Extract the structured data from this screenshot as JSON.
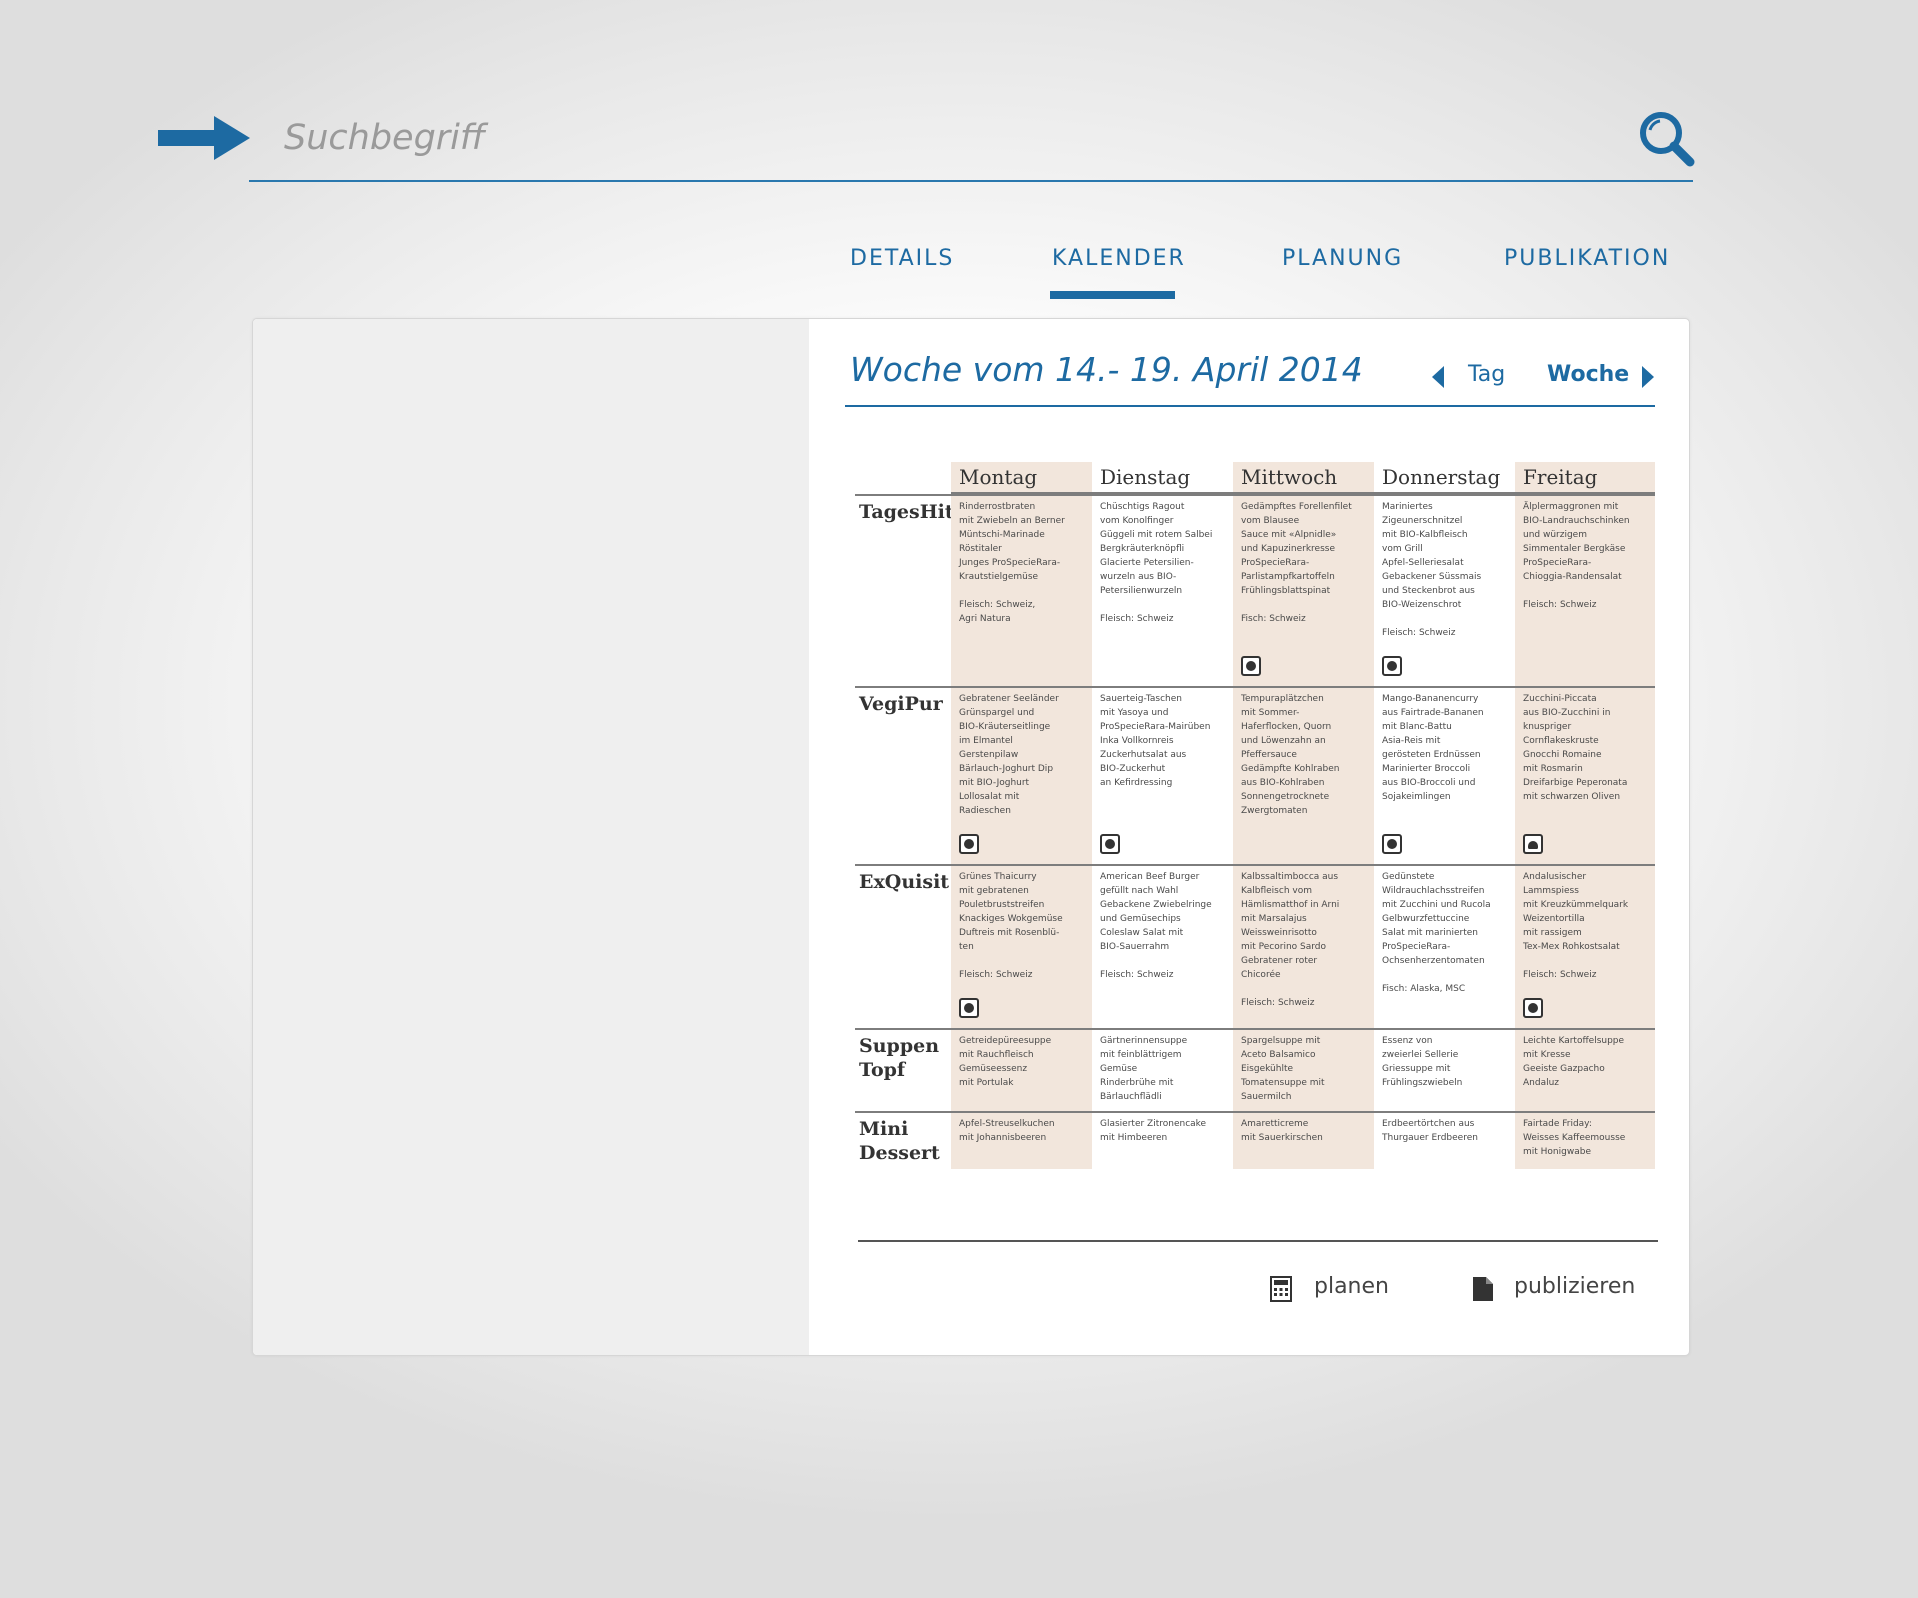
{
  "search": {
    "placeholder": "Suchbegriff"
  },
  "tabs": [
    {
      "label": "DETAILS"
    },
    {
      "label": "KALENDER",
      "active": true
    },
    {
      "label": "PLANUNG"
    },
    {
      "label": "PUBLIKATION"
    }
  ],
  "calendar": {
    "week_title": "Woche vom 14.- 19. April 2014",
    "nav_day": "Tag",
    "nav_week": "Woche"
  },
  "menu": {
    "days": [
      "Montag",
      "Dienstag",
      "Mittwoch",
      "Donnerstag",
      "Freitag"
    ],
    "rows": [
      {
        "label": "TagesHit",
        "cells": [
          {
            "text": "Rinderrostbraten\nmit Zwiebeln an Berner\nMüntschi-Marinade\nRöstitaler\nJunges ProSpecieRara-\nKrautstielgemüse\n\nFleisch: Schweiz,\nAgri Natura",
            "badge": ""
          },
          {
            "text": "Chüschtigs Ragout\nvom Konolfinger\nGüggeli mit rotem Salbei\nBergkräuterknöpfli\nGlacierte Petersilien-\nwurzeln aus BIO-\nPetersilienwurzeln\n\nFleisch: Schweiz",
            "badge": ""
          },
          {
            "text": "Gedämpftes Forellenfilet\nvom Blausee\nSauce mit «Alpnidle»\nund Kapuzinerkresse\nProSpecieRara-\nParlistampfkartoffeln\nFrühlingsblattspinat\n\nFisch: Schweiz",
            "badge": "face"
          },
          {
            "text": "Mariniertes\nZigeunerschnitzel\nmit BIO-Kalbfleisch\nvom Grill\nApfel-Selleriesalat\nGebackener Süssmais\nund Steckenbrot aus\nBIO-Weizenschrot\n\nFleisch: Schweiz",
            "badge": "face"
          },
          {
            "text": "Älplermaggronen mit\nBIO-Landrauchschinken\nund würzigem\nSimmentaler Bergkäse\nProSpecieRara-\nChioggia-Randensalat\n\nFleisch: Schweiz",
            "badge": ""
          }
        ]
      },
      {
        "label": "VegiPur",
        "cells": [
          {
            "text": "Gebratener Seeländer\nGrünspargel und\nBIO-Kräuterseitlinge\nim Elmantel\nGerstenpilaw\nBärlauch-Joghurt Dip\nmit BIO-Joghurt\nLollosalat mit\nRadieschen",
            "badge": "face"
          },
          {
            "text": "Sauerteig-Taschen\nmit Yasoya und\nProSpecieRara-Mairüben\nInka Vollkornreis\nZuckerhutsalat aus\nBIO-Zuckerhut\nan Kefirdressing",
            "badge": "face"
          },
          {
            "text": "Tempuraplätzchen\nmit Sommer-\nHaferflocken, Quorn\nund Löwenzahn an\nPfeffersauce\nGedämpfte Kohlraben\naus BIO-Kohlraben\nSonnengetrocknete\nZwergtomaten",
            "badge": ""
          },
          {
            "text": "Mango-Bananencurry\naus Fairtrade-Bananen\nmit Blanc-Battu\nAsia-Reis mit\ngerösteten Erdnüssen\nMarinierter Broccoli\naus BIO-Broccoli und\nSojakeimlingen",
            "badge": "face"
          },
          {
            "text": "Zucchini-Piccata\naus BIO-Zucchini in\nknuspriger\nCornflakeskruste\nGnocchi Romaine\nmit Rosmarin\nDreifarbige Peperonata\nmit schwarzen Oliven",
            "badge": "cloud"
          }
        ]
      },
      {
        "label": "ExQuisit",
        "cells": [
          {
            "text": "Grünes Thaicurry\nmit gebratenen\nPouletbruststreifen\nKnackiges Wokgemüse\nDuftreis mit Rosenblü-\nten\n\nFleisch: Schweiz",
            "badge": "face"
          },
          {
            "text": "American Beef Burger\ngefüllt nach Wahl\nGebackene Zwiebelringe\nund Gemüsechips\nColeslaw Salat mit\nBIO-Sauerrahm\n\nFleisch: Schweiz",
            "badge": ""
          },
          {
            "text": "Kalbssaltimbocca aus\nKalbfleisch vom\nHämlismatthof in Arni\nmit Marsalajus\nWeissweinrisotto\nmit Pecorino Sardo\nGebratener roter\nChicorée\n\nFleisch: Schweiz",
            "badge": ""
          },
          {
            "text": "Gedünstete\nWildrauchlachsstreifen\nmit Zucchini und Rucola\nGelbwurzfettuccine\nSalat mit marinierten\nProSpecieRara-\nOchsenherzentomaten\n\nFisch: Alaska, MSC",
            "badge": ""
          },
          {
            "text": "Andalusischer\nLammspiess\nmit Kreuzkümmelquark\nWeizentortilla\nmit rassigem\nTex-Mex Rohkostsalat\n\nFleisch: Schweiz",
            "badge": "face"
          }
        ]
      },
      {
        "label": "Suppen\nTopf",
        "cells": [
          {
            "text": "Getreidepüreesuppe\nmit Rauchfleisch\nGemüseessenz\nmit Portulak",
            "badge": ""
          },
          {
            "text": "Gärtnerinnensuppe\nmit feinblättrigem\nGemüse\nRinderbrühe mit\nBärlauchflädli",
            "badge": ""
          },
          {
            "text": "Spargelsuppe mit\nAceto Balsamico\nEisgekühlte\nTomatensuppe mit\nSauermilch",
            "badge": ""
          },
          {
            "text": "Essenz von\nzweierlei Sellerie\nGriessuppe mit\nFrühlingszwiebeln",
            "badge": ""
          },
          {
            "text": "Leichte Kartoffelsuppe\nmit Kresse\nGeeiste Gazpacho\nAndaluz",
            "badge": ""
          }
        ]
      },
      {
        "label": "Mini\nDessert",
        "cells": [
          {
            "text": "Apfel-Streuselkuchen\nmit Johannisbeeren",
            "badge": ""
          },
          {
            "text": "Glasierter Zitronencake\nmit Himbeeren",
            "badge": ""
          },
          {
            "text": "Amaretticreme\nmit Sauerkirschen",
            "badge": ""
          },
          {
            "text": "Erdbeertörtchen aus\nThurgauer Erdbeeren",
            "badge": ""
          },
          {
            "text": "Fairtade Friday:\nWeisses Kaffeemousse\nmit Honigwabe",
            "badge": ""
          }
        ]
      }
    ]
  },
  "actions": {
    "plan": "planen",
    "publish": "publizieren"
  },
  "icons": [
    "arrow-right-icon",
    "search-icon",
    "caret-left-icon",
    "caret-right-icon",
    "calculator-icon",
    "document-icon",
    "face-icon",
    "cloud-icon"
  ],
  "colors": {
    "accent": "#1d6aa2",
    "column_shade": "#f2e6dc",
    "panel_gray": "#efefef"
  }
}
